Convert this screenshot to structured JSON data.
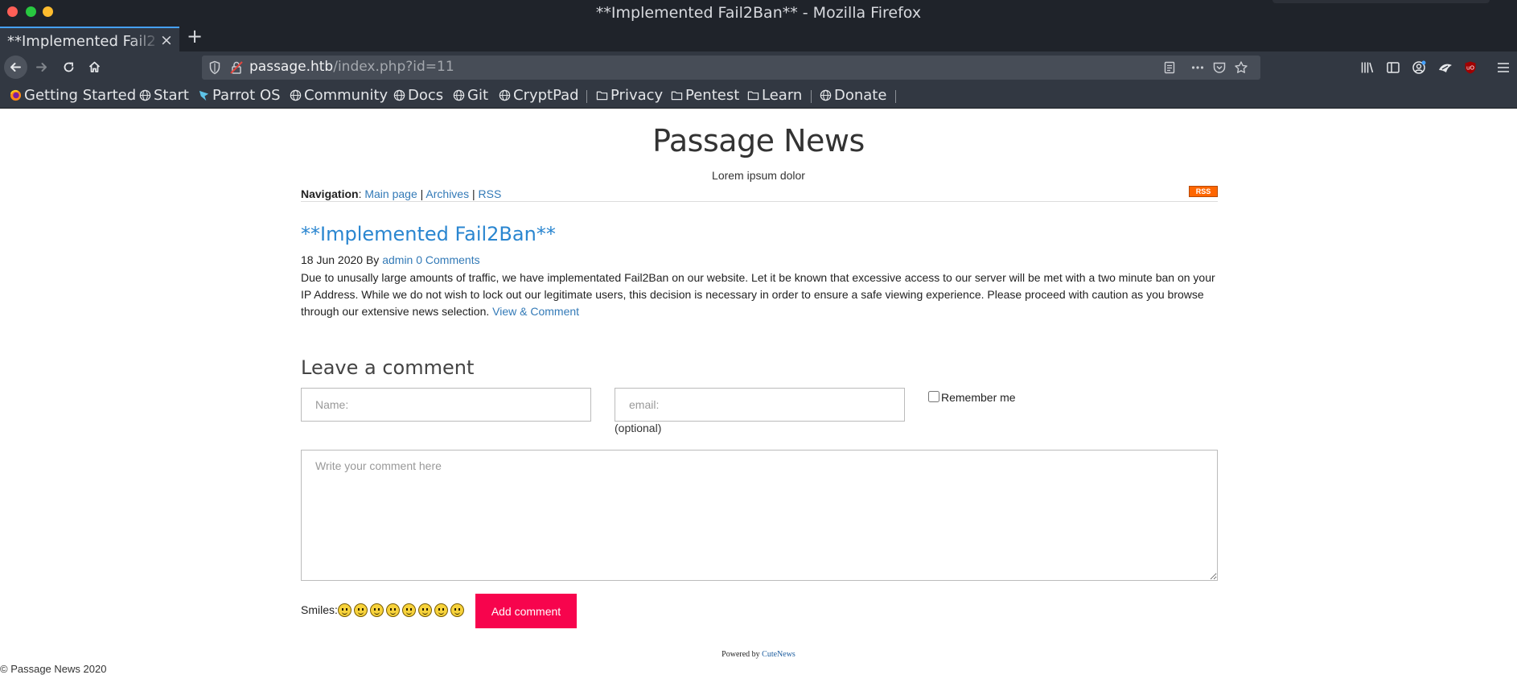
{
  "browser": {
    "window_title": "**Implemented Fail2Ban** - Mozilla Firefox",
    "tab_label": "**Implemented Fail2Ban**",
    "tab_close": "×",
    "new_tab": "+",
    "url_host": "passage.htb",
    "url_path": "/index.php?id=11",
    "accent_color": "#45a1ff",
    "bookmarks": [
      {
        "label": "Getting Started",
        "icon": "firefox-icon"
      },
      {
        "label": "Start",
        "icon": "globe-icon"
      },
      {
        "label": "Parrot OS",
        "icon": "parrot-icon"
      },
      {
        "label": "Community",
        "icon": "globe-icon"
      },
      {
        "label": "Docs",
        "icon": "globe-icon"
      },
      {
        "label": "Git",
        "icon": "globe-icon"
      },
      {
        "label": "CryptPad",
        "icon": "globe-icon"
      },
      {
        "label": "Privacy",
        "icon": "folder-icon"
      },
      {
        "label": "Pentest",
        "icon": "folder-icon"
      },
      {
        "label": "Learn",
        "icon": "folder-icon"
      },
      {
        "label": "Donate",
        "icon": "globe-icon"
      }
    ]
  },
  "site": {
    "title": "Passage News",
    "subtitle": "Lorem ipsum dolor",
    "navigation_label": "Navigation",
    "nav_links": [
      "Main page",
      "Archives",
      "RSS"
    ],
    "rss_badge": "RSS"
  },
  "post": {
    "title": "**Implemented Fail2Ban**",
    "date": "18 Jun 2020",
    "by": "By",
    "author": "admin",
    "comments_link": "0 Comments",
    "body": "Due to unusally large amounts of traffic, we have implementated Fail2Ban on our website. Let it be known that excessive access to our server will be met with a two minute ban on your IP Address. While we do not wish to lock out our legitimate users, this decision is necessary in order to ensure a safe viewing experience. Please proceed with caution as you browse through our extensive news selection.",
    "view_link": "View & Comment"
  },
  "comment_form": {
    "heading": "Leave a comment",
    "name_placeholder": "Name:",
    "email_placeholder": "email:",
    "optional_note": "(optional)",
    "remember_label": "Remember me",
    "comment_placeholder": "Write your comment here",
    "smiles_label": "Smiles:",
    "submit_label": "Add comment",
    "submit_color": "#f7044d"
  },
  "footer": {
    "powered_by": "Powered by",
    "powered_link": "CuteNews",
    "copyright": "© Passage News 2020"
  }
}
